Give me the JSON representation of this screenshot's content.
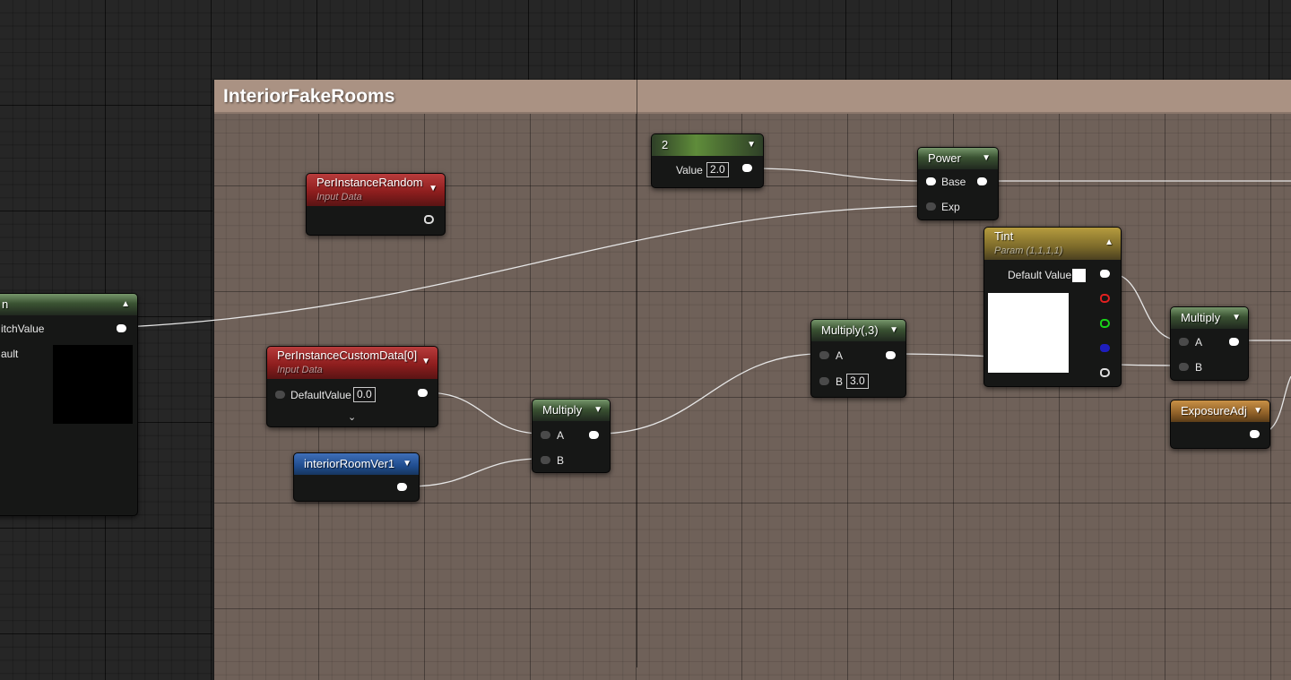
{
  "comment": {
    "title": "InteriorFakeRooms"
  },
  "nodes": {
    "switch_param": {
      "partial_title": "n",
      "row1": "itchValue",
      "row2": "ault"
    },
    "per_instance_random": {
      "title": "PerInstanceRandom",
      "subtitle": "Input Data"
    },
    "per_instance_custom": {
      "title": "PerInstanceCustomData[0]",
      "subtitle": "Input Data",
      "row_label": "DefaultValue",
      "row_value": "0.0"
    },
    "interior_room": {
      "title": "interiorRoomVer1"
    },
    "constant": {
      "title": "2",
      "label": "Value",
      "value": "2.0"
    },
    "multiply_1": {
      "title": "Multiply",
      "pin_a": "A",
      "pin_b": "B"
    },
    "multiply_3": {
      "title": "Multiply(,3)",
      "pin_a": "A",
      "pin_b": "B",
      "b_value": "3.0"
    },
    "power": {
      "title": "Power",
      "pin_base": "Base",
      "pin_exp": "Exp"
    },
    "tint": {
      "title": "Tint",
      "subtitle": "Param (1,1,1,1)",
      "default_label": "Default Value",
      "default_color": "#ffffff"
    },
    "multiply_2": {
      "title": "Multiply",
      "pin_a": "A",
      "pin_b": "B"
    },
    "exposure": {
      "title": "ExposureAdj"
    }
  },
  "colors": {
    "pin_red": "#e02020",
    "pin_green": "#18d218",
    "pin_blue": "#1e1ebe"
  }
}
